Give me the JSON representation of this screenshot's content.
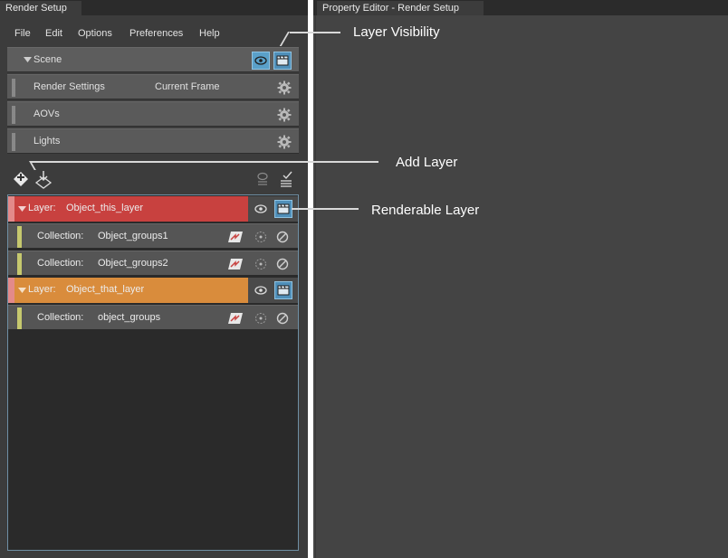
{
  "left_window": {
    "tab_title": "Render Setup",
    "menu": [
      "File",
      "Edit",
      "Options",
      "Preferences",
      "Help"
    ],
    "scene": {
      "label": "Scene"
    },
    "settings_rows": [
      {
        "label": "Render Settings",
        "value": "Current Frame"
      },
      {
        "label": "AOVs"
      },
      {
        "label": "Lights"
      }
    ]
  },
  "layers": [
    {
      "prefix": "Layer:",
      "name": "Object_this_layer",
      "color": "#c8413f",
      "strip_color": "#e38a8a",
      "collections": [
        {
          "prefix": "Collection:",
          "name": "Object_groups1"
        },
        {
          "prefix": "Collection:",
          "name": "Object_groups2"
        }
      ]
    },
    {
      "prefix": "Layer:",
      "name": "Object_that_layer",
      "color": "#d98c3c",
      "strip_color": "#e38a8a",
      "collections": [
        {
          "prefix": "Collection:",
          "name": "object_groups"
        }
      ]
    }
  ],
  "right_window": {
    "tab_title": "Property Editor - Render Setup"
  },
  "annotations": {
    "layer_visibility": "Layer Visibility",
    "add_layer": "Add Layer",
    "renderable_layer": "Renderable Layer"
  },
  "colors": {
    "accent": "#5aa0c9",
    "collection_strip": "#c6c86e"
  }
}
